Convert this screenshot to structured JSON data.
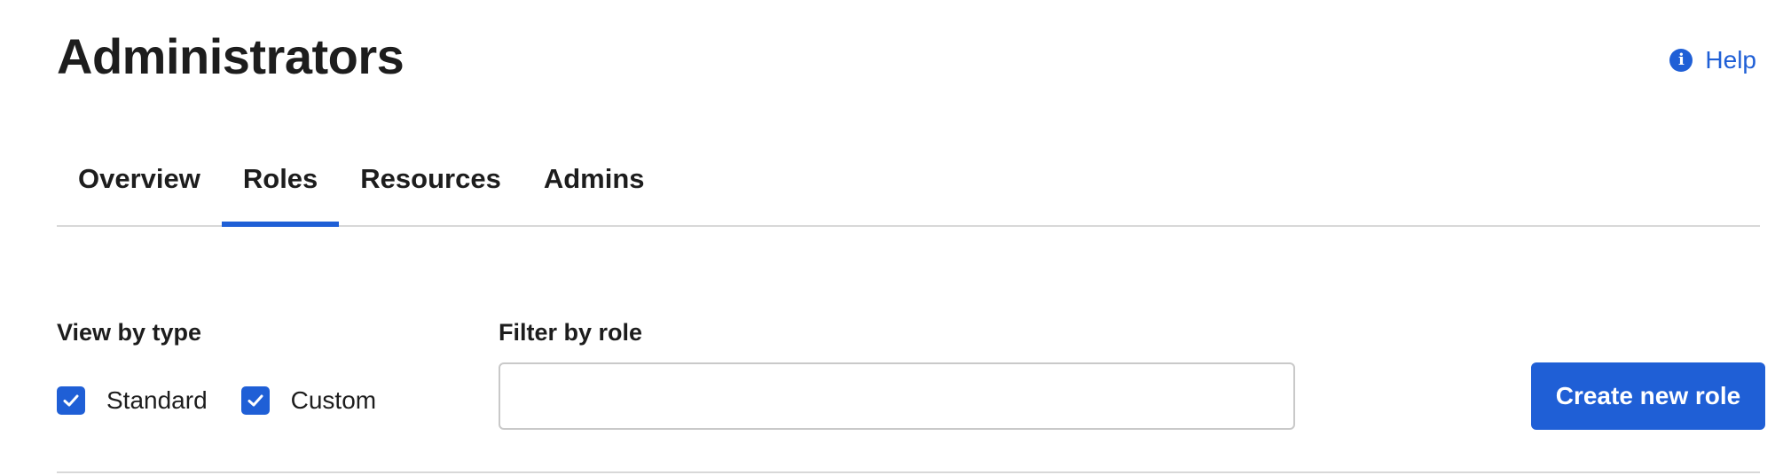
{
  "header": {
    "title": "Administrators",
    "help_label": "Help",
    "help_icon": "info-icon",
    "help_icon_glyph": "i"
  },
  "tabs": [
    {
      "label": "Overview",
      "active": false
    },
    {
      "label": "Roles",
      "active": true
    },
    {
      "label": "Resources",
      "active": false
    },
    {
      "label": "Admins",
      "active": false
    }
  ],
  "filters": {
    "view_by_type_label": "View by type",
    "types": [
      {
        "label": "Standard",
        "checked": true
      },
      {
        "label": "Custom",
        "checked": true
      }
    ],
    "filter_by_role_label": "Filter by role",
    "filter_value": "",
    "filter_placeholder": ""
  },
  "actions": {
    "create_role_label": "Create new role"
  },
  "colors": {
    "accent": "#1f5fd6",
    "text": "#1d1d1d",
    "divider": "#d8d8d8"
  }
}
